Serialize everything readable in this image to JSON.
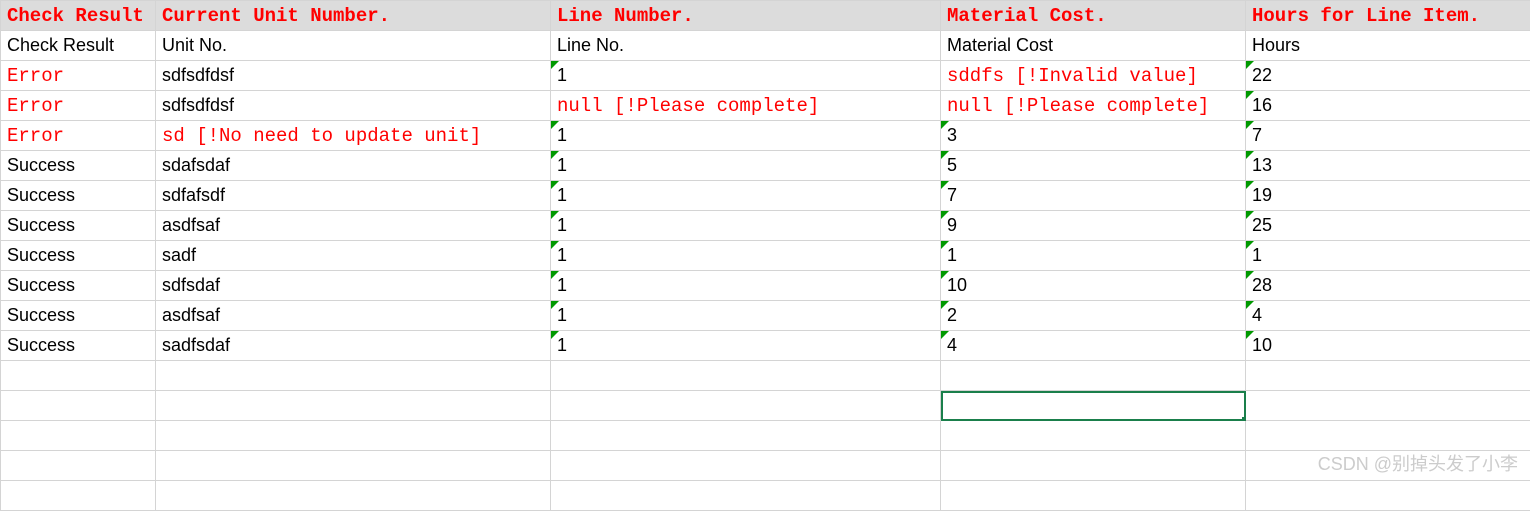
{
  "header": {
    "col1": "Check Result",
    "col2": "Current Unit Number.",
    "col3": "Line Number.",
    "col4": "Material Cost.",
    "col5": "Hours for Line Item."
  },
  "subheader": {
    "col1": "Check Result",
    "col2": "Unit No.",
    "col3": "Line No.",
    "col4": "Material Cost",
    "col5": "Hours"
  },
  "rows": [
    {
      "status": "Error",
      "status_err": true,
      "unit": "sdfsdfdsf",
      "unit_err": false,
      "line": "1",
      "line_err": false,
      "line_mark": true,
      "mat": "sddfs [!Invalid value]",
      "mat_err": true,
      "mat_mark": false,
      "hours": "22",
      "hours_mark": true
    },
    {
      "status": "Error",
      "status_err": true,
      "unit": "sdfsdfdsf",
      "unit_err": false,
      "line": "null [!Please complete]",
      "line_err": true,
      "line_mark": false,
      "mat": "null [!Please complete]",
      "mat_err": true,
      "mat_mark": false,
      "hours": "16",
      "hours_mark": true
    },
    {
      "status": "Error",
      "status_err": true,
      "unit": "sd [!No need to update unit]",
      "unit_err": true,
      "line": "1",
      "line_err": false,
      "line_mark": true,
      "mat": "3",
      "mat_err": false,
      "mat_mark": true,
      "hours": "7",
      "hours_mark": true
    },
    {
      "status": "Success",
      "status_err": false,
      "unit": "sdafsdaf",
      "unit_err": false,
      "line": "1",
      "line_err": false,
      "line_mark": true,
      "mat": "5",
      "mat_err": false,
      "mat_mark": true,
      "hours": "13",
      "hours_mark": true
    },
    {
      "status": "Success",
      "status_err": false,
      "unit": "sdfafsdf",
      "unit_err": false,
      "line": "1",
      "line_err": false,
      "line_mark": true,
      "mat": "7",
      "mat_err": false,
      "mat_mark": true,
      "hours": "19",
      "hours_mark": true
    },
    {
      "status": "Success",
      "status_err": false,
      "unit": "asdfsaf",
      "unit_err": false,
      "line": "1",
      "line_err": false,
      "line_mark": true,
      "mat": "9",
      "mat_err": false,
      "mat_mark": true,
      "hours": "25",
      "hours_mark": true
    },
    {
      "status": "Success",
      "status_err": false,
      "unit": "sadf",
      "unit_err": false,
      "line": "1",
      "line_err": false,
      "line_mark": true,
      "mat": "1",
      "mat_err": false,
      "mat_mark": true,
      "hours": "1",
      "hours_mark": true
    },
    {
      "status": "Success",
      "status_err": false,
      "unit": "sdfsdaf",
      "unit_err": false,
      "line": "1",
      "line_err": false,
      "line_mark": true,
      "mat": "10",
      "mat_err": false,
      "mat_mark": true,
      "hours": "28",
      "hours_mark": true
    },
    {
      "status": "Success",
      "status_err": false,
      "unit": "asdfsaf",
      "unit_err": false,
      "line": "1",
      "line_err": false,
      "line_mark": true,
      "mat": "2",
      "mat_err": false,
      "mat_mark": true,
      "hours": "4",
      "hours_mark": true
    },
    {
      "status": "Success",
      "status_err": false,
      "unit": "sadfsdaf",
      "unit_err": false,
      "line": "1",
      "line_err": false,
      "line_mark": true,
      "mat": "4",
      "mat_err": false,
      "mat_mark": true,
      "hours": "10",
      "hours_mark": true
    }
  ],
  "empty_rows": 5,
  "selected_cell": {
    "row_index": 13,
    "col_index": 3
  },
  "watermark": "CSDN @别掉头发了小李"
}
